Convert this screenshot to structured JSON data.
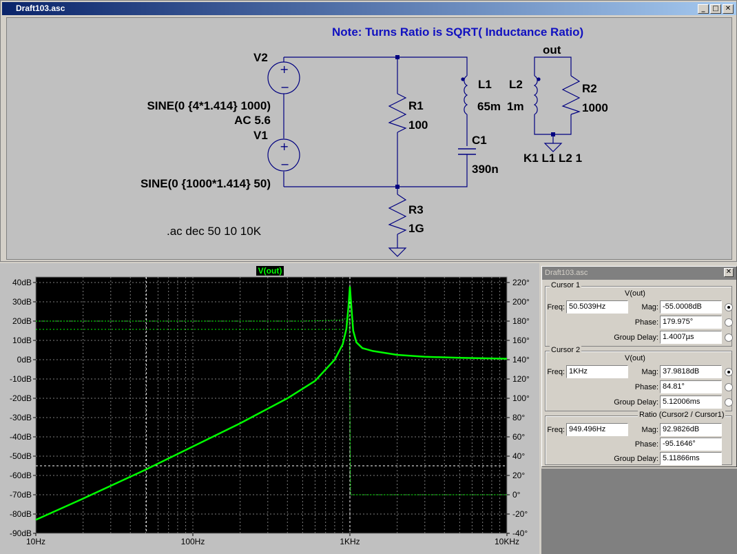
{
  "schematic": {
    "window_title": "Draft103.asc",
    "note": "Note: Turns Ratio is SQRT( Inductance Ratio)",
    "components": {
      "V2": "V2",
      "V2_value": "SINE(0 {4*1.414} 1000)",
      "V2_ac": "AC 5.6",
      "V1": "V1",
      "V1_value": "SINE(0 {1000*1.414} 50)",
      "R1": "R1",
      "R1_value": "100",
      "R3": "R3",
      "R3_value": "1G",
      "L1": "L1",
      "L1_value": "65m",
      "C1": "C1",
      "C1_value": "390n",
      "L2": "L2",
      "L2_value": "1m",
      "R2": "R2",
      "R2_value": "1000",
      "out_label": "out",
      "coupling": "K1 L1 L2 1"
    },
    "directive": ".ac dec 50 10 10K"
  },
  "plot": {
    "trace_label": "V(out)",
    "trace_color": "#00ff00",
    "bg_color": "#000000",
    "left_ticks": [
      "40dB",
      "30dB",
      "20dB",
      "10dB",
      "0dB",
      "-10dB",
      "-20dB",
      "-30dB",
      "-40dB",
      "-50dB",
      "-60dB",
      "-70dB",
      "-80dB",
      "-90dB"
    ],
    "right_ticks": [
      "220°",
      "200°",
      "180°",
      "160°",
      "140°",
      "120°",
      "100°",
      "80°",
      "60°",
      "40°",
      "20°",
      "0°",
      "-20°",
      "-40°"
    ],
    "x_ticks": [
      "10Hz",
      "100Hz",
      "1KHz",
      "10KHz"
    ]
  },
  "chart_data": {
    "type": "line",
    "x_scale": "log",
    "xlim_hz": [
      10,
      10000
    ],
    "ylim_db": [
      -90,
      40
    ],
    "ylim_phase_deg": [
      -40,
      220
    ],
    "grid": true,
    "series": [
      {
        "name": "V(out)",
        "axis": "magnitude_db",
        "x": [
          10,
          20,
          50,
          100,
          200,
          400,
          600,
          800,
          900,
          950,
          980,
          1000,
          1020,
          1050,
          1100,
          1200,
          1400,
          2000,
          3000,
          5000,
          10000
        ],
        "y": [
          -83,
          -72,
          -57,
          -45,
          -33,
          -20,
          -11,
          0,
          8,
          16,
          28,
          37.9,
          28,
          15,
          9,
          6,
          4.5,
          2.5,
          1.5,
          1,
          0.5
        ]
      },
      {
        "axis": "phase_deg",
        "x": [
          10,
          50,
          100,
          500,
          900,
          990,
          1000,
          1010,
          1050,
          2000,
          10000
        ],
        "y": [
          180,
          180,
          180,
          180,
          181,
          185,
          90,
          0,
          0,
          0,
          0
        ]
      }
    ]
  },
  "cursors": {
    "window_title": "Draft103.asc",
    "close": "✕",
    "cursor1": {
      "label": "Cursor 1",
      "trace": "V(out)",
      "freq_label": "Freq:",
      "freq": "50.5039Hz",
      "mag_label": "Mag:",
      "mag": "-55.0008dB",
      "phase_label": "Phase:",
      "phase": "179.975°",
      "gd_label": "Group Delay:",
      "gd": "1.4007µs"
    },
    "cursor2": {
      "label": "Cursor 2",
      "trace": "V(out)",
      "freq_label": "Freq:",
      "freq": "1KHz",
      "mag_label": "Mag:",
      "mag": "37.9818dB",
      "phase_label": "Phase:",
      "phase": "84.81°",
      "gd_label": "Group Delay:",
      "gd": "5.12006ms"
    },
    "ratio": {
      "label": "Ratio (Cursor2 / Cursor1)",
      "freq_label": "Freq:",
      "freq": "949.496Hz",
      "mag_label": "Mag:",
      "mag": "92.9826dB",
      "phase_label": "Phase:",
      "phase": "-95.1646°",
      "gd_label": "Group Delay:",
      "gd": "5.11866ms"
    }
  }
}
